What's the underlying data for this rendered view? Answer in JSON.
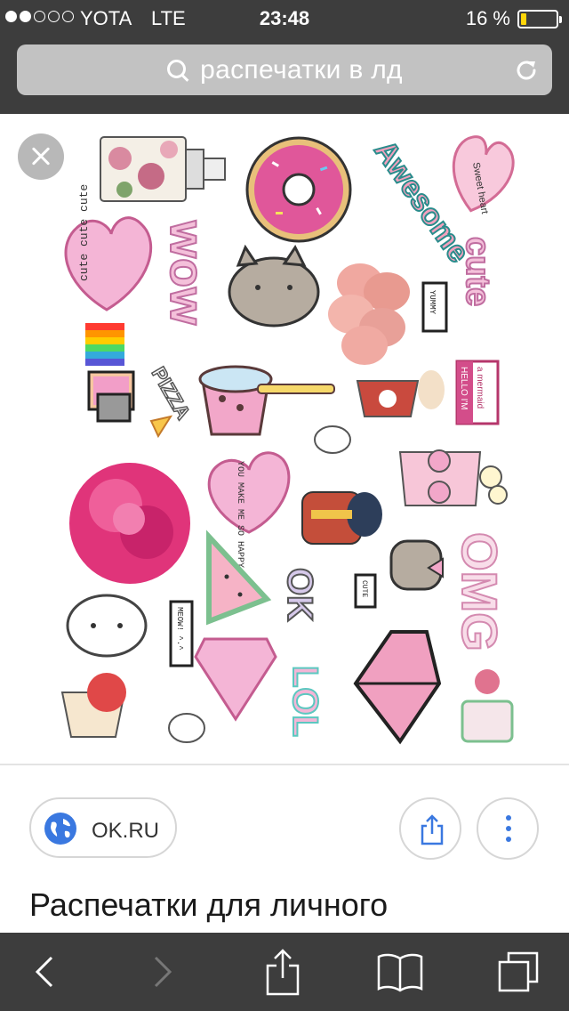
{
  "status_bar": {
    "carrier": "YOTA",
    "network": "LTE",
    "time": "23:48",
    "battery_text": "16 %",
    "battery_level": 0.16,
    "signal_bars_filled": 2,
    "signal_bars_total": 5
  },
  "address_bar": {
    "query": "распечатки в лд"
  },
  "image_viewer": {
    "sticker_texts": {
      "sweet_heart": "Sweet heart",
      "awesome": "Awesome",
      "cute_heart": "cute cute cute",
      "wow": "wow",
      "cute_drip": "cute",
      "yummy": "YUMMY",
      "hello_mermaid_1": "HELLO I'M",
      "hello_mermaid_2": "a mermaid",
      "pizza": "PIZZA",
      "you_make_me_happy": "YOU MAKE ME SO HAPPY",
      "omg": "OMG",
      "ok": "OK",
      "cute_bubble": "CUTE",
      "meow": "MEOW! ^.^",
      "lol": "LOL"
    }
  },
  "result": {
    "source": "OK.RU",
    "title": "Распечатки для личного"
  },
  "colors": {
    "chrome": "#3d3d3d",
    "accent_blue": "#3a78e0",
    "pink": "#f2a7c9",
    "teal": "#5cc8c0"
  },
  "icons": {
    "search": "search-icon",
    "reload": "reload-icon",
    "close": "close-icon",
    "globe": "globe-icon",
    "share": "share-icon",
    "more": "more-vertical-icon",
    "back": "chevron-left-icon",
    "forward": "chevron-right-icon",
    "bookmarks": "book-icon",
    "tabs": "tabs-icon"
  }
}
